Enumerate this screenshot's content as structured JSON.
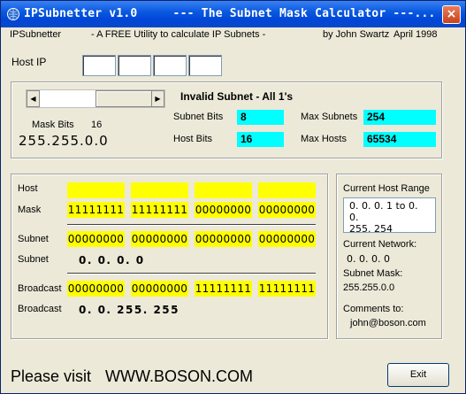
{
  "window": {
    "title": "IPSubnetter v1.0     --- The Subnet Mask Calculator ---...",
    "close_glyph": "×"
  },
  "header": {
    "app_name": "IPSubnetter",
    "tagline": "- A FREE Utility to calculate IP Subnets -",
    "author": "by John Swartz",
    "date": "April 1998"
  },
  "host_ip": {
    "label": "Host IP",
    "octets": [
      "",
      "",
      "",
      ""
    ]
  },
  "mask_panel": {
    "status": "Invalid Subnet - All 1's",
    "mask_bits_label": "Mask Bits",
    "mask_bits_value": "16",
    "mask_display": "255.255.0.0",
    "subnet_bits_label": "Subnet Bits",
    "subnet_bits_value": "8",
    "host_bits_label": "Host Bits",
    "host_bits_value": "16",
    "max_subnets_label": "Max Subnets",
    "max_subnets_value": "254",
    "max_hosts_label": "Max Hosts",
    "max_hosts_value": "65534",
    "slider_left_glyph": "◀",
    "slider_right_glyph": "▶"
  },
  "binary_panel": {
    "host_label": "Host",
    "host_octets": [
      "",
      "",
      "",
      ""
    ],
    "mask_label": "Mask",
    "mask_octets": [
      "11111111",
      "11111111",
      "00000000",
      "00000000"
    ],
    "subnet_label": "Subnet",
    "subnet_octets": [
      "00000000",
      "00000000",
      "00000000",
      "00000000"
    ],
    "subnet_dec_label": "Subnet",
    "subnet_dec": "0. 0. 0. 0",
    "broadcast_label": "Broadcast",
    "broadcast_octets": [
      "00000000",
      "00000000",
      "11111111",
      "11111111"
    ],
    "broadcast_dec_label": "Broadcast",
    "broadcast_dec": "0. 0. 255. 255"
  },
  "info_panel": {
    "range_label": "Current Host Range",
    "range_line1": "0. 0. 0. 1  to  0. 0.",
    "range_line2": "255. 254",
    "network_label": "Current Network:",
    "network_value": "0. 0. 0. 0",
    "subnet_mask_label": "Subnet Mask:",
    "subnet_mask_value": "255.255.0.0",
    "comments_label": "Comments to:",
    "comments_value": "john@boson.com"
  },
  "footer": {
    "visit_label": "Please visit",
    "url": "WWW.BOSON.COM",
    "exit_label": "Exit"
  },
  "colors": {
    "cyan_field": "#00ffff",
    "yellow_field": "#ffff00",
    "title_blue": "#0a5ae0"
  }
}
